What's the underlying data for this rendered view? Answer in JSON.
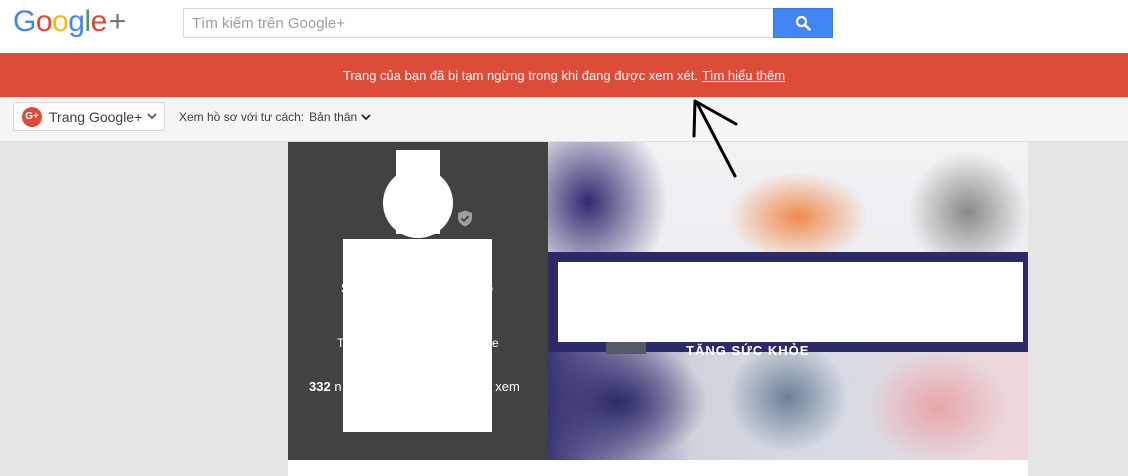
{
  "header": {
    "logo": {
      "text": "Google+",
      "letters": [
        "G",
        "o",
        "o",
        "g",
        "l",
        "e"
      ],
      "plus": "+"
    },
    "search": {
      "placeholder": "Tìm kiếm trên Google+",
      "value": ""
    },
    "search_button_icon": "search-icon"
  },
  "banner": {
    "message": "Trang của bạn đã bị tạm ngừng trong khi đang được xem xét.",
    "link": "Tìm hiểu thêm",
    "color": "#dd4b39"
  },
  "subbar": {
    "page_selector": {
      "badge": "G+",
      "label": "Trang Google+"
    },
    "view_as_label": "Xem hồ sơ với tư cách:",
    "view_as_value": "Bản thân"
  },
  "profile": {
    "name_left": "S",
    "name_right": "o",
    "tagline_left": "T",
    "tagline_right": "e",
    "stat_left_count": "332",
    "stat_left_suffix": "n",
    "stat_right": "t xem"
  },
  "cover": {
    "text": "TĂNG SỨC KHỎE"
  },
  "colors": {
    "accent_blue": "#4285f4",
    "banner_red": "#dd4b39",
    "profile_dark": "#424242"
  }
}
